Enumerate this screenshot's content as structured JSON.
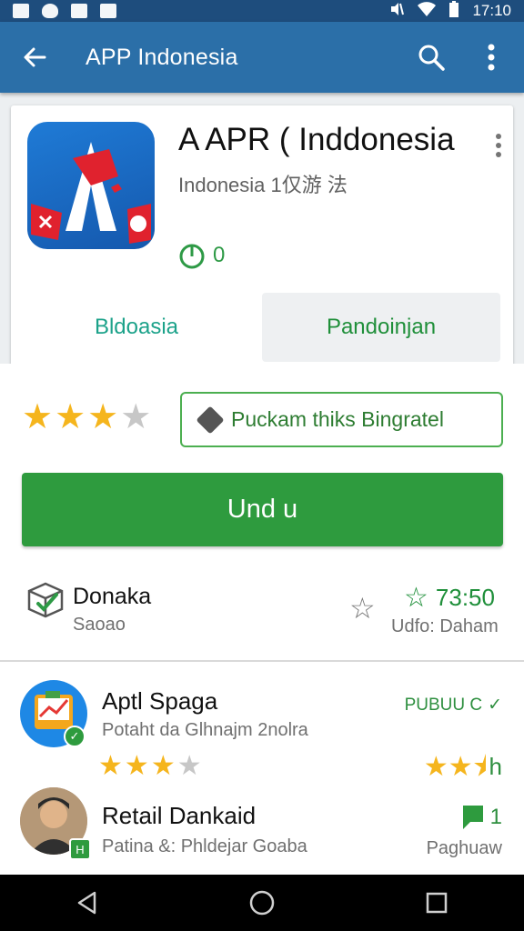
{
  "status_bar": {
    "time": "17:10"
  },
  "app_bar": {
    "title": "APP Indonesia"
  },
  "app": {
    "name": "A APR ( Inddonesia",
    "subtitle": "Indonesia  1仅游 法",
    "rating_badge": "0",
    "tabs": [
      {
        "label": "Bldoasia"
      },
      {
        "label": "Pandoinjan"
      }
    ]
  },
  "rating": {
    "value": 3.5,
    "max": 5
  },
  "promo_button": {
    "label": "Puckam thiks Bingratel"
  },
  "install_button": {
    "label": "Und u"
  },
  "info": {
    "title": "Donaka",
    "subtitle": "Saoao",
    "score": "73:50",
    "updated": "Udfo: Daham"
  },
  "list": [
    {
      "title": "Aptl Spaga",
      "subtitle": "Potaht da Glhnajm 2nolra",
      "right_label": "PUBUU C",
      "rating": 3,
      "right_stars_text": "★★⯨",
      "right_stars_suffix": "h"
    },
    {
      "title": "Retail Dankaid",
      "subtitle": "Patina &: Phldejar Goaba",
      "right_count": "1",
      "right_sub": "Paghuaw"
    }
  ],
  "colors": {
    "status_bar": "#1e4d7d",
    "app_bar": "#2b6fa8",
    "accent_green": "#2e9b3e",
    "star": "#f5b51d"
  }
}
